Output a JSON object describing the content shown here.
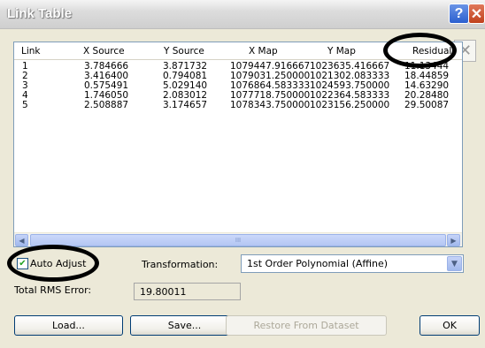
{
  "window": {
    "title": "Link Table",
    "help_icon": "?",
    "close_icon": "✕",
    "side_close_icon": "✕"
  },
  "table": {
    "columns": [
      "Link",
      "X Source",
      "Y Source",
      "X Map",
      "Y Map",
      "Residual"
    ],
    "rows": [
      [
        "1",
        "3.784666",
        "3.871732",
        "1079447.916667",
        "1023635.416667",
        "11.13444"
      ],
      [
        "2",
        "3.416400",
        "0.794081",
        "1079031.250000",
        "1021302.083333",
        "18.44859"
      ],
      [
        "3",
        "0.575491",
        "5.029140",
        "1076864.583333",
        "1024593.750000",
        "14.63290"
      ],
      [
        "4",
        "1.746050",
        "2.083012",
        "1077718.750000",
        "1022364.583333",
        "20.28480"
      ],
      [
        "5",
        "2.508887",
        "3.174657",
        "1078343.750000",
        "1023156.250000",
        "29.50087"
      ]
    ]
  },
  "scrollbar": {
    "left_arrow": "◀",
    "right_arrow": "▶",
    "thumb_grip": "III"
  },
  "auto_adjust": {
    "label": "Auto Adjust",
    "checked": true,
    "check_glyph": "✔"
  },
  "transformation": {
    "label": "Transformation:",
    "value": "1st Order Polynomial (Affine)",
    "arrow": "▼"
  },
  "rms": {
    "label": "Total RMS Error:",
    "value": "19.80011"
  },
  "buttons": {
    "load": "Load...",
    "save": "Save...",
    "restore": "Restore From Dataset",
    "ok": "OK"
  }
}
